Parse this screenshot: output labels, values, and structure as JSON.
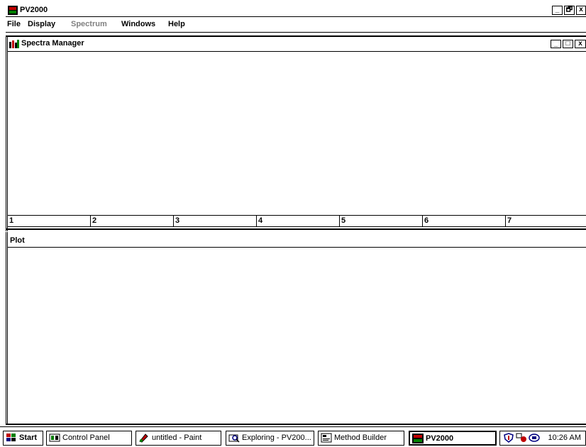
{
  "window": {
    "title": "PV2000",
    "controls": {
      "minimize": "_",
      "restore": "🗗",
      "close": "x"
    }
  },
  "menu": {
    "items": [
      {
        "label": "File",
        "enabled": true
      },
      {
        "label": "Display",
        "enabled": true
      },
      {
        "label": "Spectrum",
        "enabled": false
      },
      {
        "label": "Windows",
        "enabled": true
      },
      {
        "label": "Help",
        "enabled": true
      }
    ]
  },
  "spectra_manager": {
    "title": "Spectra Manager",
    "slots": [
      "1",
      "2",
      "3",
      "4",
      "5",
      "6",
      "7"
    ]
  },
  "plot": {
    "title": "Plot"
  },
  "taskbar": {
    "start_label": "Start",
    "tasks": [
      {
        "label": "Control Panel",
        "icon": "control-panel-icon"
      },
      {
        "label": "untitled - Paint",
        "icon": "paint-icon"
      },
      {
        "label": "Exploring - PV200...",
        "icon": "explorer-icon"
      },
      {
        "label": "Method Builder",
        "icon": "method-builder-icon"
      },
      {
        "label": "PV2000",
        "icon": "pv2000-icon",
        "active": true
      }
    ],
    "clock": "10:26 AM"
  },
  "colors": {
    "background": "#ffffff",
    "text": "#000000",
    "disabled_text": "#808080",
    "icon_accent_red": "#c00000",
    "icon_accent_green": "#008000"
  }
}
